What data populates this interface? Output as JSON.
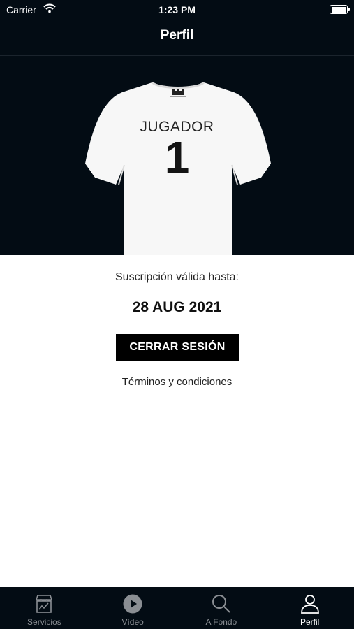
{
  "status_bar": {
    "carrier": "Carrier",
    "time": "1:23 PM"
  },
  "nav": {
    "title": "Perfil"
  },
  "jersey": {
    "name": "JUGADOR",
    "number": "1"
  },
  "subscription": {
    "label": "Suscripción válida hasta:",
    "date": "28 AUG 2021"
  },
  "actions": {
    "logout_label": "CERRAR SESIÓN",
    "terms_label": "Términos y condiciones"
  },
  "tabs": [
    {
      "label": "Servicios",
      "icon": "store-icon",
      "active": false
    },
    {
      "label": "Vídeo",
      "icon": "play-icon",
      "active": false
    },
    {
      "label": "A Fondo",
      "icon": "search-icon",
      "active": false
    },
    {
      "label": "Perfil",
      "icon": "user-icon",
      "active": true
    }
  ],
  "colors": {
    "dark_bg": "#030c14",
    "accent": "#000000",
    "tab_inactive": "#8a8e93",
    "tab_active": "#ffffff"
  }
}
